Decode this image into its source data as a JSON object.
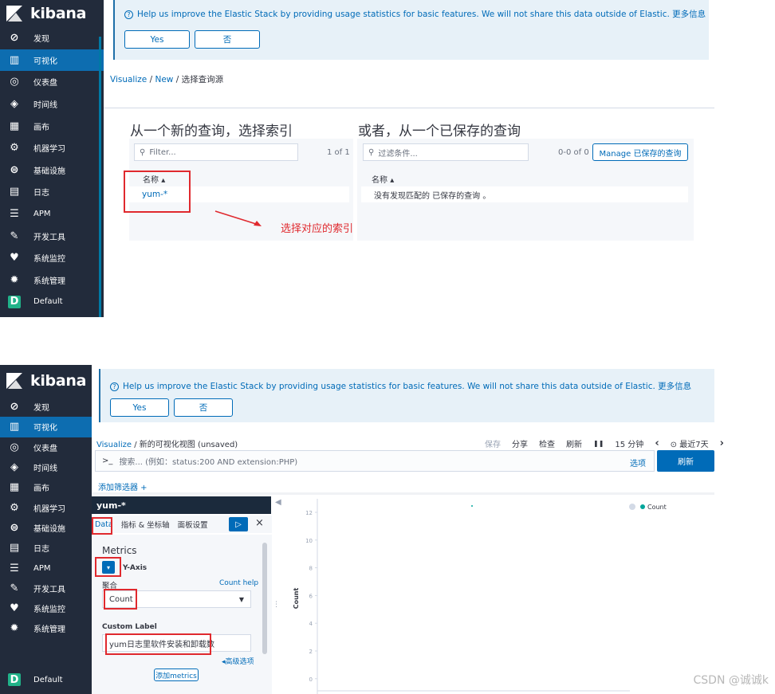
{
  "sidebar": {
    "brand": "kibana",
    "items": [
      {
        "label": "发现",
        "icon": "compass-icon"
      },
      {
        "label": "可视化",
        "icon": "visualize-icon"
      },
      {
        "label": "仪表盘",
        "icon": "dashboard-icon"
      },
      {
        "label": "时间线",
        "icon": "timelion-icon"
      },
      {
        "label": "画布",
        "icon": "canvas-icon"
      },
      {
        "label": "机器学习",
        "icon": "machine-learning-icon"
      },
      {
        "label": "基础设施",
        "icon": "infrastructure-icon"
      },
      {
        "label": "日志",
        "icon": "logs-icon"
      },
      {
        "label": "APM",
        "icon": "apm-icon"
      },
      {
        "label": "开发工具",
        "icon": "wrench-icon"
      },
      {
        "label": "系统监控",
        "icon": "heart-icon"
      },
      {
        "label": "系统管理",
        "icon": "gear-icon"
      }
    ],
    "space_badge": "D",
    "space_label": "Default"
  },
  "banner": {
    "message": "Help us improve the Elastic Stack by providing usage statistics for basic features. We will not share this data outside of Elastic. 更多信息",
    "yes": "Yes",
    "no": "否"
  },
  "screen1": {
    "crumb_visualize": "Visualize",
    "crumb_new": "New",
    "crumb_current": "选择查询源",
    "new_search_title": "从一个新的查询，选择索引",
    "saved_search_title": "或者，从一个已保存的查询",
    "filter_placeholder": "Filter...",
    "filter_count": "1 of 1",
    "saved_filter_placeholder": "过滤条件...",
    "saved_count": "0-0 of 0",
    "manage_button": "Manage 已保存的查询",
    "name_header": "名称",
    "index_item": "yum-*",
    "saved_name_header": "名称",
    "no_saved": "没有发现匹配的 已保存的查询 。",
    "annotation": "选择对应的索引"
  },
  "screen2": {
    "crumb_visualize": "Visualize",
    "crumb_current": "新的可视化视图 (unsaved)",
    "toolbar": {
      "save": "保存",
      "share": "分享",
      "inspect": "检查",
      "refresh": "刷新",
      "pause": "❚❚",
      "interval": "15 分钟",
      "prev": "‹",
      "range": "⊙ 最近7天",
      "next": "›"
    },
    "query_prompt": ">_",
    "query_placeholder": "搜索... (例如：status:200 AND extension:PHP)",
    "options": "选项",
    "refresh_button": "刷新",
    "add_filter": "添加筛选器 +",
    "index_name": "yum-*",
    "tabs": {
      "data": "Data",
      "metrics_axes": "指标 & 坐标轴",
      "panel_settings": "面板设置"
    },
    "apply": "▷",
    "close": "×",
    "metrics_title": "Metrics",
    "y_axis": "Y-Axis",
    "agg_label": "聚合",
    "count_help": "Count help",
    "agg_value": "Count",
    "custom_label": "Custom Label",
    "custom_label_value": "yum日志里软件安装和卸载数",
    "advanced": "◂高级选项",
    "add_metrics": "添加metrics"
  },
  "chart_data": {
    "type": "bar",
    "ylabel": "Count",
    "yticks": [
      "12",
      "10",
      "8",
      "6",
      "4",
      "2",
      "0"
    ],
    "legend": [
      {
        "name": "Count",
        "color": "#00a69b"
      }
    ],
    "legend_position": "top-right"
  },
  "watermark": "CSDN @诚诚k"
}
